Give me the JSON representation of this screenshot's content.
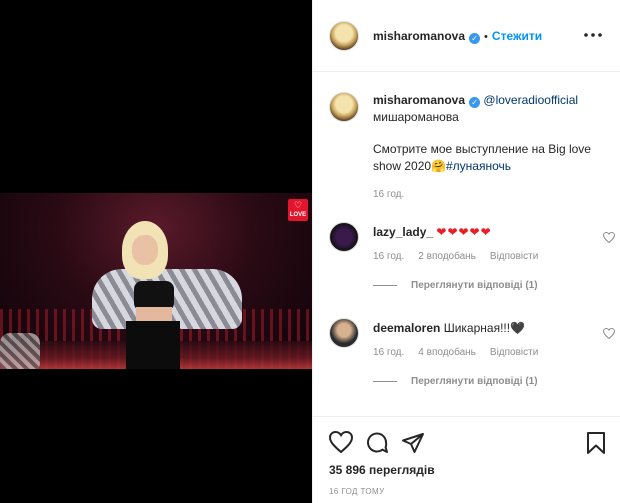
{
  "post": {
    "username": "misharomanova",
    "follow_label": "Стежити",
    "caption_mention": "@loveradioofficial",
    "caption_line1": "мишароманова",
    "caption_line2": "Смотрите мое выступление на Big love show 2020🤗",
    "caption_hashtag": "#лунаяночь",
    "caption_time": "16 год.",
    "media_badge": "LOVE",
    "views": "35 896 переглядів",
    "posted_ago": "16 ГОД ТОМУ"
  },
  "comments": [
    {
      "username": "lazy_lady_",
      "text": "❤❤❤❤❤",
      "time": "16 год.",
      "likes": "2 вподобань",
      "reply": "Відповісти",
      "view_replies": "Переглянути відповіді (1)"
    },
    {
      "username": "deemaloren",
      "text": "Шикарная!!!🖤",
      "time": "16 год.",
      "likes": "4 вподобань",
      "reply": "Відповісти",
      "view_replies": "Переглянути відповіді (1)"
    }
  ],
  "colors": {
    "accent": "#0095f6",
    "verified": "#3897f0",
    "muted": "#8e8e8e",
    "heart_red": "#ed1c24"
  },
  "icons": [
    "heart-icon",
    "comment-icon",
    "share-icon",
    "bookmark-icon",
    "more-icon",
    "verified-icon"
  ]
}
